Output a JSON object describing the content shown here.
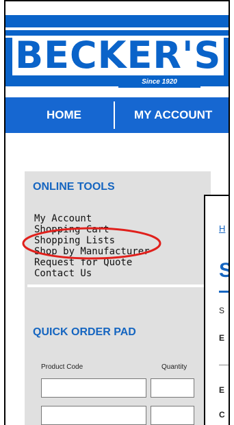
{
  "logo": {
    "name": "BECKER'S",
    "tagline": "Since 1920"
  },
  "nav": {
    "home": "HOME",
    "my_account": "MY ACCOUNT"
  },
  "online_tools": {
    "title": "ONLINE TOOLS",
    "links": [
      "My Account",
      "Shopping Cart",
      "Shopping Lists",
      "Shop by Manufacturer",
      "Request for Quote",
      "Contact Us"
    ]
  },
  "quick_order": {
    "title": "QUICK ORDER PAD",
    "product_code_label": "Product Code",
    "quantity_label": "Quantity"
  },
  "content": {
    "crumb": "H",
    "heading": "S",
    "line1": "S",
    "line2": "E",
    "line3": "E",
    "line4": "C"
  },
  "highlight_color": "#e0201c",
  "brand_color": "#0a63c9"
}
